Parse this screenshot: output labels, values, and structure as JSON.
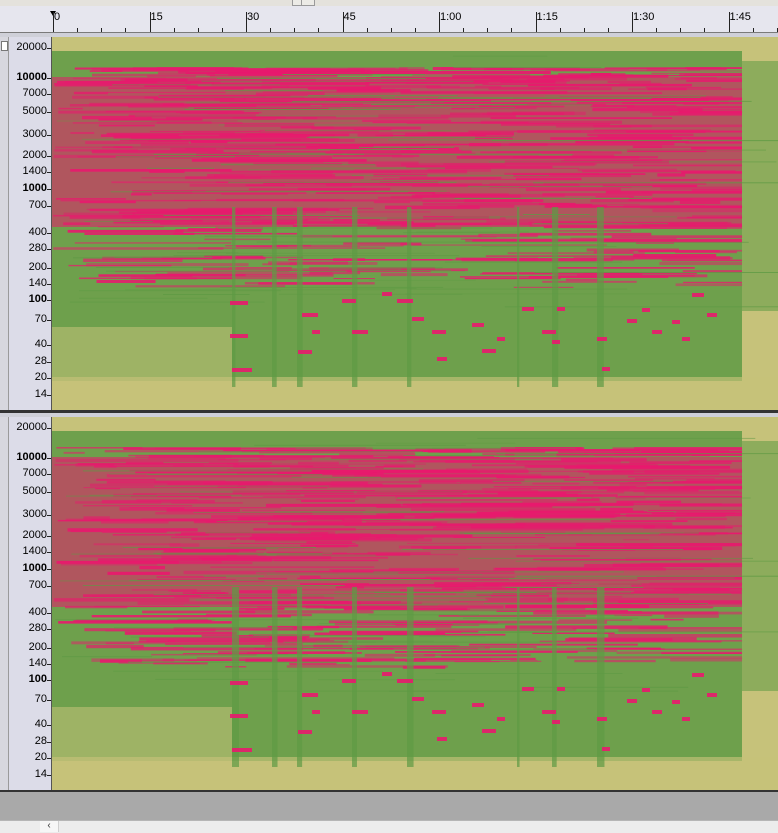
{
  "timeline": {
    "labels": [
      "0",
      "15",
      "30",
      "45",
      "1:00",
      "1:15",
      "1:30",
      "1:45"
    ]
  },
  "tracks": [
    {
      "name": "upper-channel",
      "freq_labels": [
        {
          "text": "20000",
          "bold": false
        },
        {
          "text": "10000",
          "bold": true
        },
        {
          "text": "7000",
          "bold": false
        },
        {
          "text": "5000",
          "bold": false
        },
        {
          "text": "3000",
          "bold": false
        },
        {
          "text": "2000",
          "bold": false
        },
        {
          "text": "1400",
          "bold": false
        },
        {
          "text": "1000",
          "bold": true
        },
        {
          "text": "700",
          "bold": false
        },
        {
          "text": "400",
          "bold": false
        },
        {
          "text": "280",
          "bold": false
        },
        {
          "text": "200",
          "bold": false
        },
        {
          "text": "140",
          "bold": false
        },
        {
          "text": "100",
          "bold": true
        },
        {
          "text": "70",
          "bold": false
        },
        {
          "text": "40",
          "bold": false
        },
        {
          "text": "28",
          "bold": false
        },
        {
          "text": "20",
          "bold": false
        },
        {
          "text": "14",
          "bold": false
        }
      ]
    },
    {
      "name": "lower-channel",
      "freq_labels": [
        {
          "text": "20000",
          "bold": false
        },
        {
          "text": "10000",
          "bold": true
        },
        {
          "text": "7000",
          "bold": false
        },
        {
          "text": "5000",
          "bold": false
        },
        {
          "text": "3000",
          "bold": false
        },
        {
          "text": "2000",
          "bold": false
        },
        {
          "text": "1400",
          "bold": false
        },
        {
          "text": "1000",
          "bold": true
        },
        {
          "text": "700",
          "bold": false
        },
        {
          "text": "400",
          "bold": false
        },
        {
          "text": "280",
          "bold": false
        },
        {
          "text": "200",
          "bold": false
        },
        {
          "text": "140",
          "bold": false
        },
        {
          "text": "100",
          "bold": true
        },
        {
          "text": "70",
          "bold": false
        },
        {
          "text": "40",
          "bold": false
        },
        {
          "text": "28",
          "bold": false
        },
        {
          "text": "20",
          "bold": false
        },
        {
          "text": "14",
          "bold": false
        }
      ]
    }
  ],
  "colors": {
    "background": "#c6c27a",
    "low_energy": "#5e9a44",
    "high_energy": "#e8196e"
  },
  "icons": {
    "scroll_left": "‹"
  }
}
